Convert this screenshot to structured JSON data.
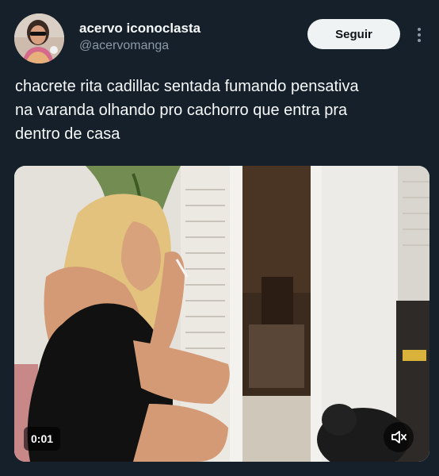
{
  "author": {
    "display_name": "acervo iconoclasta",
    "handle": "@acervomanga",
    "avatar_icon": "avatar-photo"
  },
  "actions": {
    "follow_label": "Seguir",
    "more_icon": "more-options-icon"
  },
  "tweet": {
    "lines": [
      "chacrete rita cadillac sentada fumando pensativa",
      "na varanda olhando pro cachorro que entra pra",
      "dentro de casa"
    ]
  },
  "video": {
    "time": "0:01",
    "mute_icon": "speaker-muted-icon"
  },
  "colors": {
    "background": "#15202b",
    "text_primary": "#f7f9f9",
    "text_secondary": "#8b98a5",
    "follow_button_bg": "#eff3f4"
  }
}
